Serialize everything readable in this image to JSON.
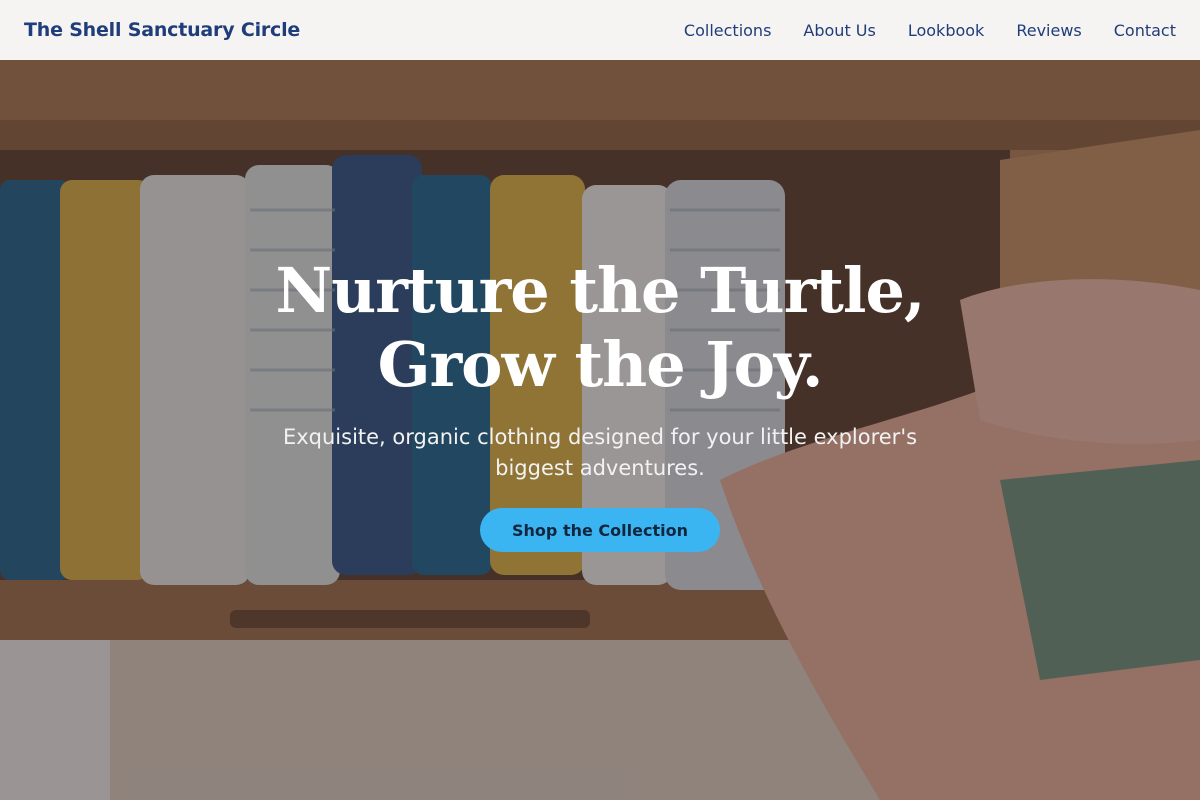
{
  "navbar": {
    "brand": "The Shell Sanctuary Circle",
    "links": [
      "Collections",
      "About Us",
      "Lookbook",
      "Reviews",
      "Contact"
    ]
  },
  "hero": {
    "title_line1": "Nurture the Turtle,",
    "title_line2": "Grow the Joy.",
    "subtitle": "Exquisite, organic clothing designed for your little explorer's biggest adventures.",
    "cta_label": "Shop the Collection",
    "background": "photo-folded-baby-blankets-in-drawer"
  },
  "colors": {
    "brand": "#1f3d7a",
    "cta": "#3bb4f2",
    "navbar_bg": "#f6f4f3"
  }
}
